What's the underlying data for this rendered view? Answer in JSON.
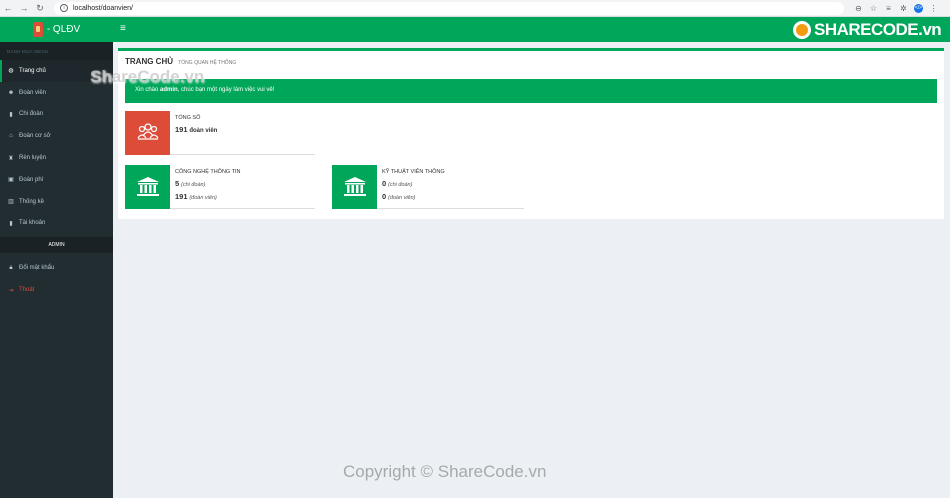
{
  "browser": {
    "url": "localhost/doanvien/"
  },
  "sidebar": {
    "logo_text": "- QLĐV",
    "menu_header": "DANH MỤC MENU",
    "items": [
      {
        "label": "Trang chủ",
        "icon": "dashboard-icon",
        "active": true
      },
      {
        "label": "Đoàn viên",
        "icon": "users-icon"
      },
      {
        "label": "Chi đoàn",
        "icon": "book-icon"
      },
      {
        "label": "Đoàn cơ sở",
        "icon": "bank-icon"
      },
      {
        "label": "Rèn luyện",
        "icon": "trophy-icon"
      },
      {
        "label": "Đoàn phí",
        "icon": "money-icon"
      },
      {
        "label": "Thống kê",
        "icon": "chart-icon"
      },
      {
        "label": "Tài khoản",
        "icon": "book-icon"
      }
    ],
    "admin_header": "ADMIN",
    "admin_items": [
      {
        "label": "Đổi mật khẩu",
        "icon": "lock-icon"
      },
      {
        "label": "Thoát",
        "icon": "sign-out-icon"
      }
    ]
  },
  "topbar": {
    "brand": "SHARECODE.vn"
  },
  "main": {
    "title": "TRANG CHỦ",
    "subtitle": "TỔNG QUAN HỆ THỐNG",
    "alert_prefix": "Xin chào ",
    "alert_user": "admin",
    "alert_suffix": ", chúc bạn một ngày làm việc vui vẻ!",
    "boxes": {
      "total": {
        "label": "TỔNG SỐ",
        "count": "191",
        "unit": "đoàn viên",
        "color": "#dd4b39"
      },
      "cntt": {
        "label": "CÔNG NGHỆ THÔNG TIN",
        "chi_doan_count": "5",
        "chi_doan_unit": "(chi đoàn)",
        "doan_vien_count": "191",
        "doan_vien_unit": "(đoàn viên)",
        "color": "#00a65a"
      },
      "ktvt": {
        "label": "KỸ THUẬT VIỄN THÔNG",
        "chi_doan_count": "0",
        "chi_doan_unit": "(chi đoàn)",
        "doan_vien_count": "0",
        "doan_vien_unit": "(đoàn viên)",
        "color": "#00a65a"
      }
    }
  },
  "watermarks": {
    "top": "ShareCode.vn",
    "bottom": "Copyright © ShareCode.vn"
  }
}
